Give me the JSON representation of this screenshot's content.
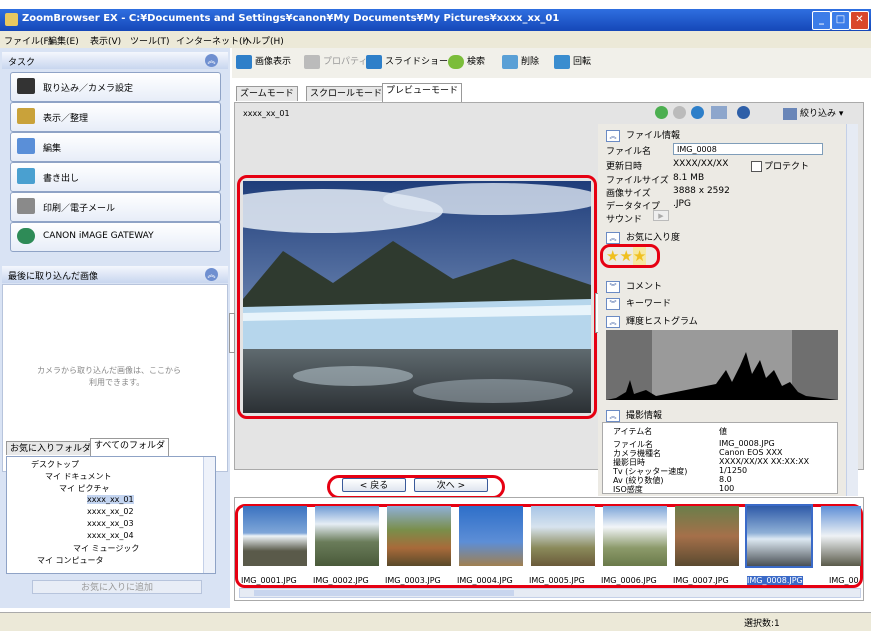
{
  "window": {
    "title": "ZoomBrowser EX  -  C:¥Documents and Settings¥canon¥My Documents¥My Pictures¥xxxx_xx_01"
  },
  "menu": [
    "ファイル(F)",
    "編集(E)",
    "表示(V)",
    "ツール(T)",
    "インターネット(I)",
    "ヘルプ(H)"
  ],
  "task_pane": {
    "title": "タスク",
    "buttons": [
      "取り込み／カメラ設定",
      "表示／整理",
      "編集",
      "書き出し",
      "印刷／電子メール",
      "CANON iMAGE GATEWAY"
    ]
  },
  "recent_pane": {
    "title": "最後に取り込んだ画像",
    "message_line1": "カメラから取り込んだ画像は、ここから",
    "message_line2": "利用できます。"
  },
  "folder_pane": {
    "tab_favorites": "お気に入りフォルダ",
    "tab_all": "すべてのフォルダ",
    "tree": [
      "デスクトップ",
      "マイ ドキュメント",
      "マイ ピクチャ",
      "xxxx_xx_01",
      "xxxx_xx_02",
      "xxxx_xx_03",
      "xxxx_xx_04",
      "マイ ミュージック",
      "マイ コンピュータ"
    ],
    "add_favorite": "お気に入りに追加"
  },
  "toolbar": {
    "view": "画像表示",
    "properties": "プロパティ",
    "slideshow": "スライドショー",
    "search": "検索",
    "delete": "削除",
    "rotate": "回転",
    "filter": "絞り込み"
  },
  "tabs": [
    "ズームモード",
    "スクロールモード",
    "プレビューモード"
  ],
  "path_label": "xxxx_xx_01",
  "nav": {
    "back": "< 戻る",
    "next": "次へ >"
  },
  "file_info": {
    "title": "ファイル情報",
    "rows": [
      {
        "label": "ファイル名",
        "value": "IMG_0008"
      },
      {
        "label": "更新日時",
        "value": "XXXX/XX/XX"
      },
      {
        "label": "ファイルサイズ",
        "value": "8.1 MB"
      },
      {
        "label": "画像サイズ",
        "value": "3888 x 2592"
      },
      {
        "label": "データタイプ",
        "value": ".JPG"
      },
      {
        "label": "サウンド",
        "value": ""
      }
    ],
    "protect": "プロテクト",
    "rating_title": "お気に入り度",
    "rating": 3,
    "comment": "コメント",
    "keyword": "キーワード",
    "histogram": "輝度ヒストグラム"
  },
  "shooting_info": {
    "title": "撮影情報",
    "col_item": "アイテム名",
    "col_value": "値",
    "rows": [
      {
        "k": "ファイル名",
        "v": "IMG_0008.JPG"
      },
      {
        "k": "カメラ機種名",
        "v": "Canon EOS XXX"
      },
      {
        "k": "撮影日時",
        "v": "XXXX/XX/XX XX:XX:XX"
      },
      {
        "k": "Tv (シャッター速度)",
        "v": "1/1250"
      },
      {
        "k": "Av (絞り数値)",
        "v": "8.0"
      },
      {
        "k": "ISO感度",
        "v": "100"
      }
    ]
  },
  "thumbnails": [
    "IMG_0001.JPG",
    "IMG_0002.JPG",
    "IMG_0003.JPG",
    "IMG_0004.JPG",
    "IMG_0005.JPG",
    "IMG_0006.JPG",
    "IMG_0007.JPG",
    "IMG_0008.JPG",
    "IMG_00"
  ],
  "status": {
    "selected": "選択数:1"
  }
}
